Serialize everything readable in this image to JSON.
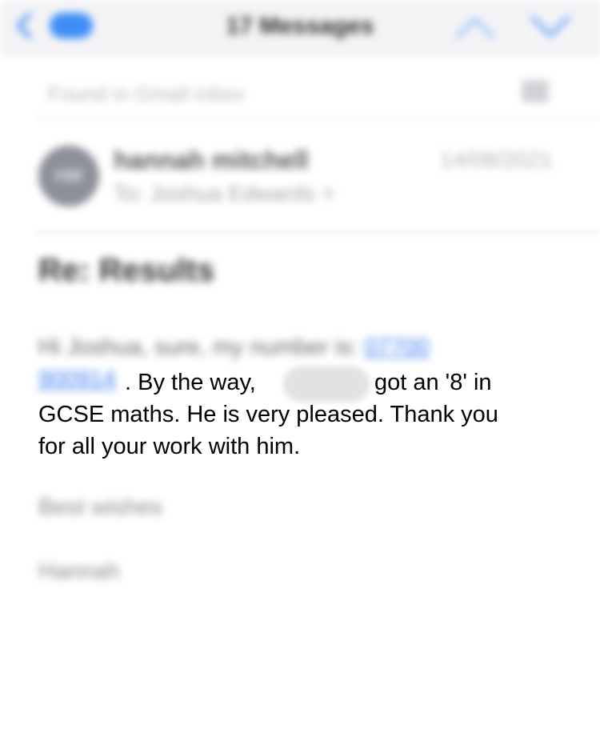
{
  "navbar": {
    "back_icon": "chevron-left-icon",
    "badge_label": "",
    "title": "17 Messages",
    "up_icon": "chevron-up-icon",
    "down_icon": "chevron-down-icon"
  },
  "found_bar": {
    "text": "Found in Gmail inbox",
    "icon": "archive-icon"
  },
  "header": {
    "avatar_initials": "HM",
    "sender": "hannah mitchell",
    "recipient": "To: Joshua Edwards >",
    "date": "14/08/2021"
  },
  "subject": "Re: Results",
  "body": {
    "line1_prefix": "Hi Joshua, sure, my number is:",
    "phone_part1": "07700",
    "phone_part2": "900914",
    "line2_text": ".  By the way,",
    "line2_after": "got an '8' in",
    "line3": "GCSE maths.  He is very pleased.  Thank you",
    "line4": "for all your work with him.",
    "closing": "Best wishes",
    "signature": "Hannah"
  },
  "colors": {
    "link": "#3f7ef0",
    "accent": "#3d8ff6"
  }
}
